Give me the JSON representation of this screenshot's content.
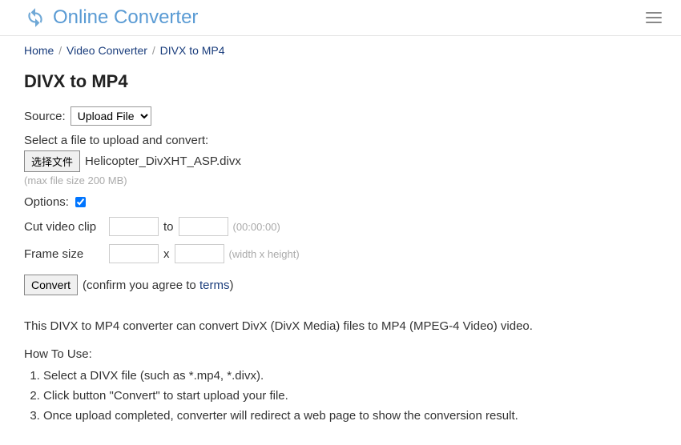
{
  "header": {
    "site_title": "Online Converter"
  },
  "breadcrumb": {
    "home": "Home",
    "video_converter": "Video Converter",
    "current": "DIVX to MP4"
  },
  "page_title": "DIVX to MP4",
  "source": {
    "label": "Source:",
    "selected": "Upload File"
  },
  "file": {
    "select_label": "Select a file to upload and convert:",
    "button_label": "选择文件",
    "file_name": "Helicopter_DivXHT_ASP.divx",
    "max_hint": "(max file size 200 MB)"
  },
  "options": {
    "label": "Options:",
    "cut_label": "Cut video clip",
    "to_label": "to",
    "cut_hint": "(00:00:00)",
    "frame_label": "Frame size",
    "x_label": "x",
    "frame_hint": "(width x height)"
  },
  "convert": {
    "button_label": "Convert",
    "confirm_prefix": "(confirm you agree to ",
    "terms_label": "terms",
    "confirm_suffix": ")"
  },
  "description": "This DIVX to MP4 converter can convert DivX (DivX Media) files to MP4 (MPEG-4 Video) video.",
  "howto": {
    "title": "How To Use:",
    "steps": [
      "Select a DIVX file (such as *.mp4, *.divx).",
      "Click button \"Convert\" to start upload your file.",
      "Once upload completed, converter will redirect a web page to show the conversion result."
    ]
  }
}
